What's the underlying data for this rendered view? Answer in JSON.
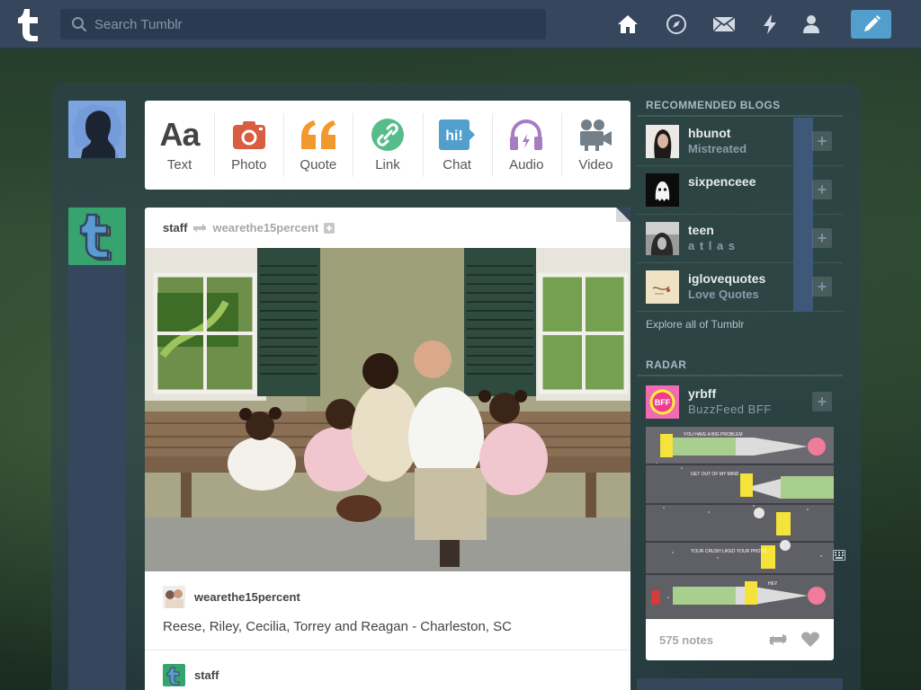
{
  "topbar": {
    "search_placeholder": "Search Tumblr",
    "nav_icons": [
      "home-icon",
      "explore-icon",
      "messages-icon",
      "activity-icon",
      "account-icon"
    ],
    "compose_icon": "pencil-icon",
    "bg_color": "#36465d",
    "compose_color": "#529ecc"
  },
  "post_types": [
    {
      "label": "Text",
      "icon": "text-icon",
      "color": "#444444"
    },
    {
      "label": "Photo",
      "icon": "camera-icon",
      "color": "#d95e40"
    },
    {
      "label": "Quote",
      "icon": "quote-icon",
      "color": "#f2992e"
    },
    {
      "label": "Link",
      "icon": "link-icon",
      "color": "#56bc8a"
    },
    {
      "label": "Chat",
      "icon": "chat-icon",
      "color": "#529ecc"
    },
    {
      "label": "Audio",
      "icon": "headphones-icon",
      "color": "#a77dc2"
    },
    {
      "label": "Video",
      "icon": "video-camera-icon",
      "color": "#748089"
    }
  ],
  "post": {
    "author": "staff",
    "reblogged_from": "wearethe15percent",
    "source_blog": "wearethe15percent",
    "caption": "Reese, Riley, Cecilia, Torrey and Reagan - Charleston, SC",
    "next_author": "staff"
  },
  "recommended": {
    "title": "RECOMMENDED BLOGS",
    "blogs": [
      {
        "name": "hbunot",
        "subtitle": "Mistreated"
      },
      {
        "name": "sixpenceee",
        "subtitle": ""
      },
      {
        "name": "teen",
        "subtitle": "a t l a s"
      },
      {
        "name": "iglovequotes",
        "subtitle": "Love Quotes"
      }
    ],
    "explore": "Explore all of Tumblr"
  },
  "radar": {
    "title": "RADAR",
    "blog": {
      "name": "yrbff",
      "subtitle": "BuzzFeed BFF"
    },
    "notes": "575 notes",
    "comic_text": [
      "YOU HAVE A BIG PROBLEM",
      "GET OUT OF MY MIND",
      "YOUR CRUSH LIKED YOUR PHOTO",
      "HEY"
    ]
  }
}
